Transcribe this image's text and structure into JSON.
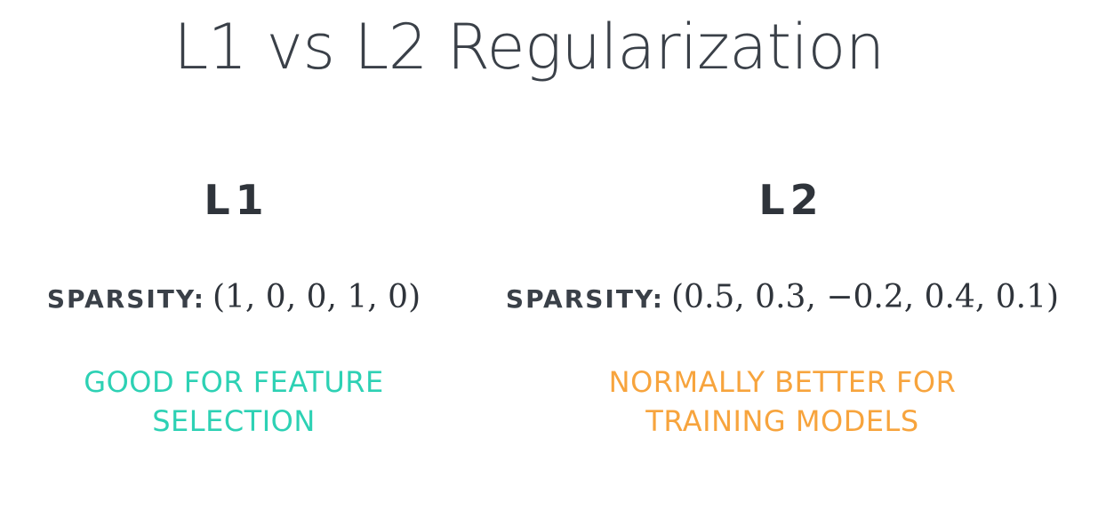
{
  "title": "L1 vs L2 Regularization",
  "columns": [
    {
      "heading": "L1",
      "sparsity_label": "SPARSITY:",
      "sparsity_vector": "(1, 0, 0, 1, 0)",
      "note_lines": [
        "GOOD FOR FEATURE",
        "SELECTION"
      ],
      "note_color": "#2dd1b4"
    },
    {
      "heading": "L2",
      "sparsity_label": "SPARSITY:",
      "sparsity_vector": "(0.5, 0.3, −0.2, 0.4, 0.1)",
      "note_lines": [
        "NORMALLY BETTER FOR",
        "TRAINING MODELS"
      ],
      "note_color": "#f7a43d"
    }
  ]
}
